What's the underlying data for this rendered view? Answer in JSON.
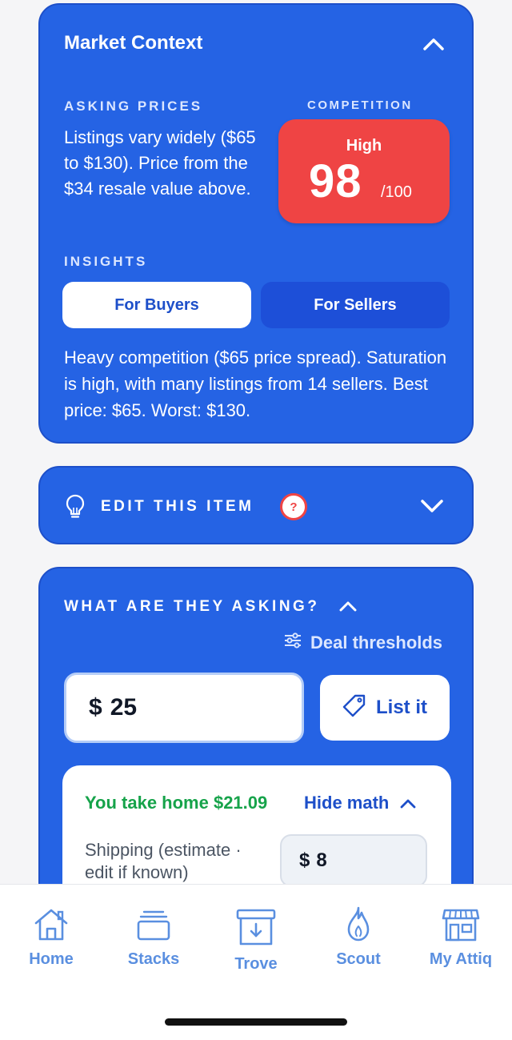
{
  "market": {
    "title": "Market Context",
    "asking_label": "ASKING PRICES",
    "asking_text": "Listings vary widely ($65 to $130). Price from the $34 resale value above.",
    "competition_label": "COMPETITION",
    "competition_level": "High",
    "competition_score": "98",
    "competition_max": "/100",
    "insights_label": "INSIGHTS",
    "tabs": [
      "For Buyers",
      "For Sellers"
    ],
    "insight_text": "Heavy competition ($65 price spread). Saturation is high, with many listings from 14 sellers. Best price: $65. Worst: $130.",
    "competition_color": "#ef4444"
  },
  "edit": {
    "title": "EDIT THIS ITEM",
    "help": "?"
  },
  "asking": {
    "title": "WHAT ARE THEY ASKING?",
    "deal_thresholds": "Deal thresholds",
    "currency": "$",
    "price_value": "25",
    "list_button": "List it",
    "take_home": "You take home $21.09",
    "hide_math": "Hide math",
    "shipping_label": "Shipping (estimate · edit if known)",
    "shipping_value": "8",
    "take_home_color": "#16a34a"
  },
  "tabbar": {
    "items": [
      {
        "label": "Home",
        "icon": "home-icon"
      },
      {
        "label": "Stacks",
        "icon": "stacks-icon"
      },
      {
        "label": "Trove",
        "icon": "trove-icon"
      },
      {
        "label": "Scout",
        "icon": "flame-icon"
      },
      {
        "label": "My Attiq",
        "icon": "store-icon"
      }
    ]
  },
  "colors": {
    "card_blue": "#2563e4",
    "accent_blue": "#1d4fc9",
    "tab_blue": "#5a8fe0"
  }
}
